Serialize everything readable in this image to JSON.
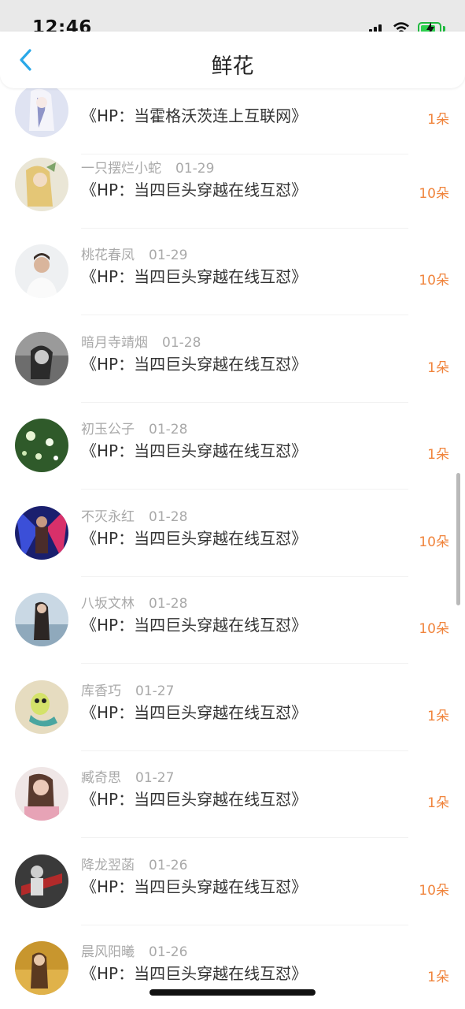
{
  "status": {
    "time": "12:46"
  },
  "nav": {
    "title": "鲜花",
    "back_icon": "chevron-left-icon"
  },
  "colors": {
    "accent": "#f0843c",
    "back": "#2aa8e8"
  },
  "rows": [
    {
      "user": "",
      "date": "",
      "book": "《HP：当霍格沃茨连上互联网》",
      "count": "1朵"
    },
    {
      "user": "一只摆烂小蛇",
      "date": "01-29",
      "book": "《HP：当四巨头穿越在线互怼》",
      "count": "10朵"
    },
    {
      "user": "桃花春凤",
      "date": "01-29",
      "book": "《HP：当四巨头穿越在线互怼》",
      "count": "10朵"
    },
    {
      "user": "暗月寺靖烟",
      "date": "01-28",
      "book": "《HP：当四巨头穿越在线互怼》",
      "count": "1朵"
    },
    {
      "user": "初玉公子",
      "date": "01-28",
      "book": "《HP：当四巨头穿越在线互怼》",
      "count": "1朵"
    },
    {
      "user": "不灭永红",
      "date": "01-28",
      "book": "《HP：当四巨头穿越在线互怼》",
      "count": "10朵"
    },
    {
      "user": "八坂文林",
      "date": "01-28",
      "book": "《HP：当四巨头穿越在线互怼》",
      "count": "10朵"
    },
    {
      "user": "库香巧",
      "date": "01-27",
      "book": "《HP：当四巨头穿越在线互怼》",
      "count": "1朵"
    },
    {
      "user": "臧奇思",
      "date": "01-27",
      "book": "《HP：当四巨头穿越在线互怼》",
      "count": "1朵"
    },
    {
      "user": "降龙翌菡",
      "date": "01-26",
      "book": "《HP：当四巨头穿越在线互怼》",
      "count": "10朵"
    },
    {
      "user": "晨风阳曦",
      "date": "01-26",
      "book": "《HP：当四巨头穿越在线互怼》",
      "count": "1朵"
    }
  ]
}
